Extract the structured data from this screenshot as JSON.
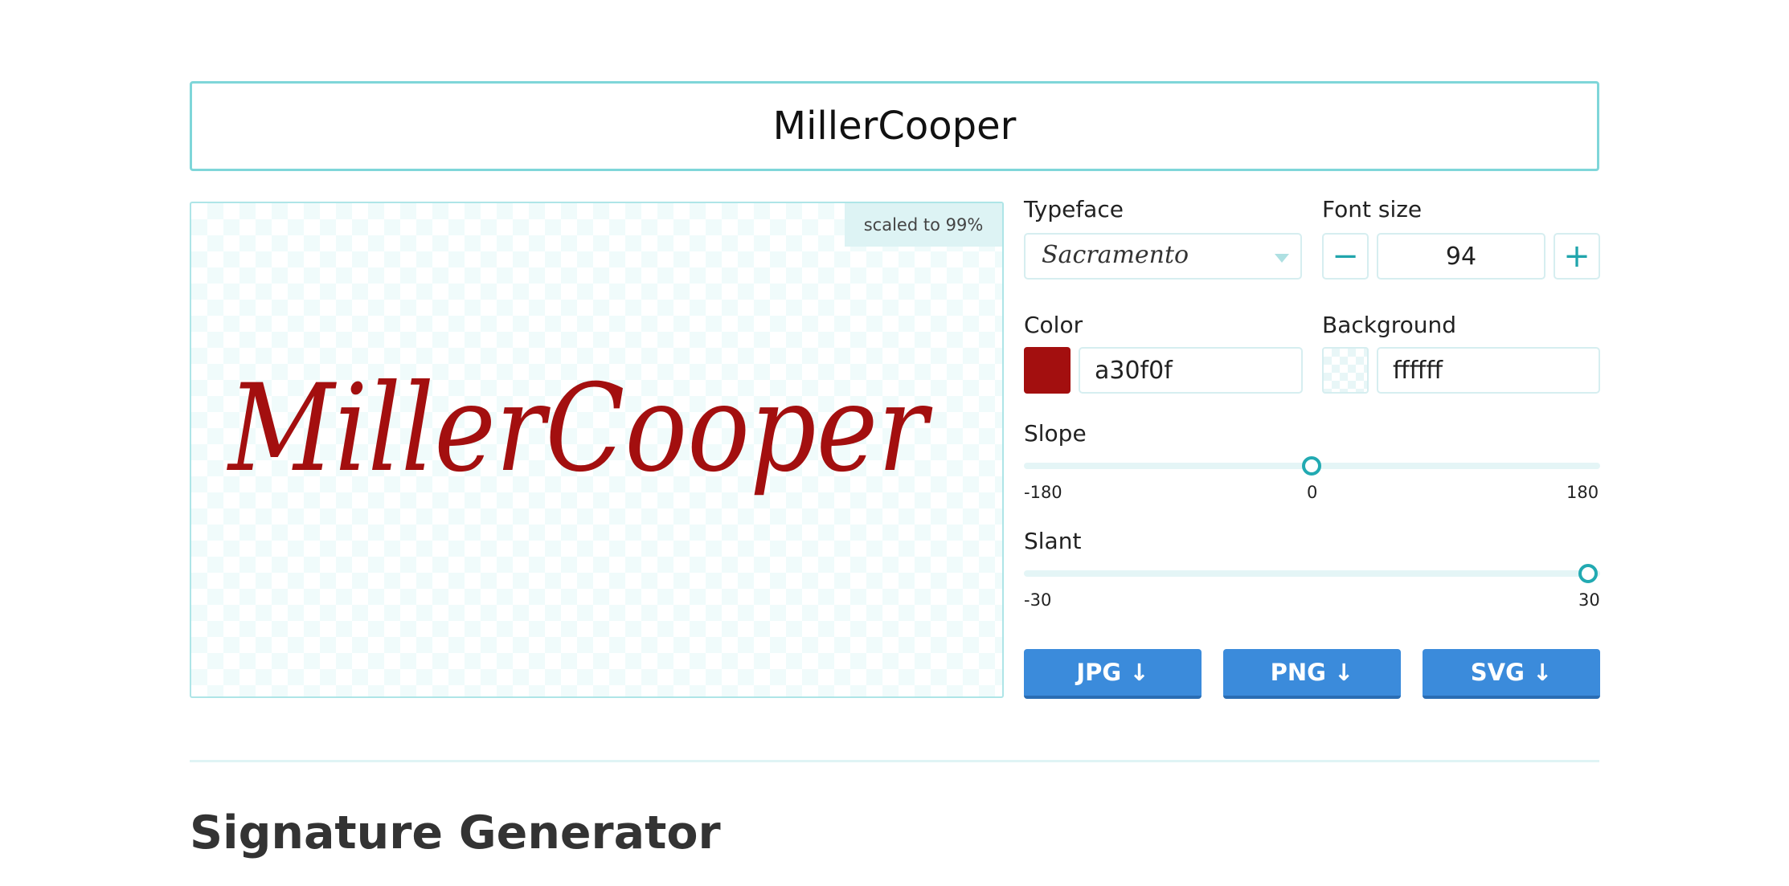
{
  "name_input": {
    "value": "MillerCooper"
  },
  "preview": {
    "signature_text": "MillerCooper",
    "scale_badge": "scaled to 99%"
  },
  "controls": {
    "typeface": {
      "label": "Typeface",
      "selected": "Sacramento"
    },
    "font_size": {
      "label": "Font size",
      "value": "94",
      "decrement": "−",
      "increment": "+"
    },
    "color": {
      "label": "Color",
      "hex": "a30f0f",
      "swatch": "#a30f0f"
    },
    "background": {
      "label": "Background",
      "hex": "ffffff",
      "swatch": "#ffffff"
    },
    "slope": {
      "label": "Slope",
      "min": "-180",
      "mid": "0",
      "max": "180",
      "value": 0
    },
    "slant": {
      "label": "Slant",
      "min": "-30",
      "max": "30",
      "value": 30
    }
  },
  "downloads": {
    "jpg": "JPG ↓",
    "png": "PNG ↓",
    "svg": "SVG ↓"
  },
  "section": {
    "heading": "Signature Generator"
  },
  "colors": {
    "accent": "#22aab2",
    "button": "#3b8bdb",
    "signature": "#a30f0f"
  }
}
